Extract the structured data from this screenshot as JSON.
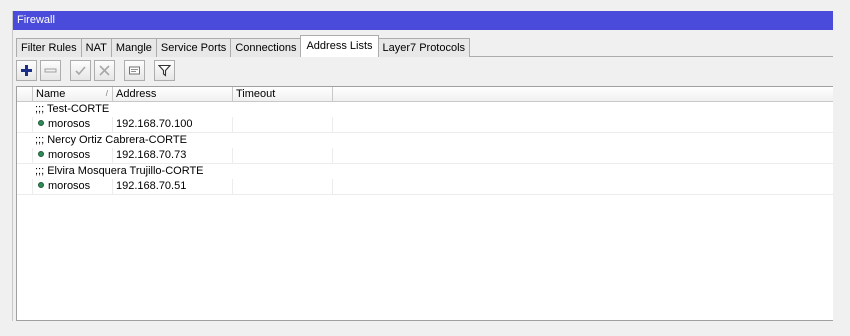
{
  "window": {
    "title": "Firewall"
  },
  "tabs": [
    {
      "label": "Filter Rules"
    },
    {
      "label": "NAT"
    },
    {
      "label": "Mangle"
    },
    {
      "label": "Service Ports"
    },
    {
      "label": "Connections"
    },
    {
      "label": "Address Lists",
      "active": true
    },
    {
      "label": "Layer7 Protocols"
    }
  ],
  "toolbar": {
    "buttons": [
      "add-icon",
      "remove-icon",
      "enable-icon",
      "disable-icon",
      "comment-icon",
      "filter-icon"
    ]
  },
  "table": {
    "headers": {
      "name": "Name",
      "address": "Address",
      "timeout": "Timeout"
    },
    "groups": [
      {
        "comment": ";;; Test-CORTE",
        "name": "morosos",
        "address": "192.168.70.100",
        "timeout": ""
      },
      {
        "comment": ";;; Nercy Ortiz Cabrera-CORTE",
        "name": "morosos",
        "address": "192.168.70.73",
        "timeout": ""
      },
      {
        "comment": ";;; Elvira Mosquera Trujillo-CORTE",
        "name": "morosos",
        "address": "192.168.70.51",
        "timeout": ""
      }
    ]
  },
  "colors": {
    "titlebar": "#4a4adb",
    "status_dot": "#2e8b57",
    "add_icon": "#1a2e8a"
  }
}
